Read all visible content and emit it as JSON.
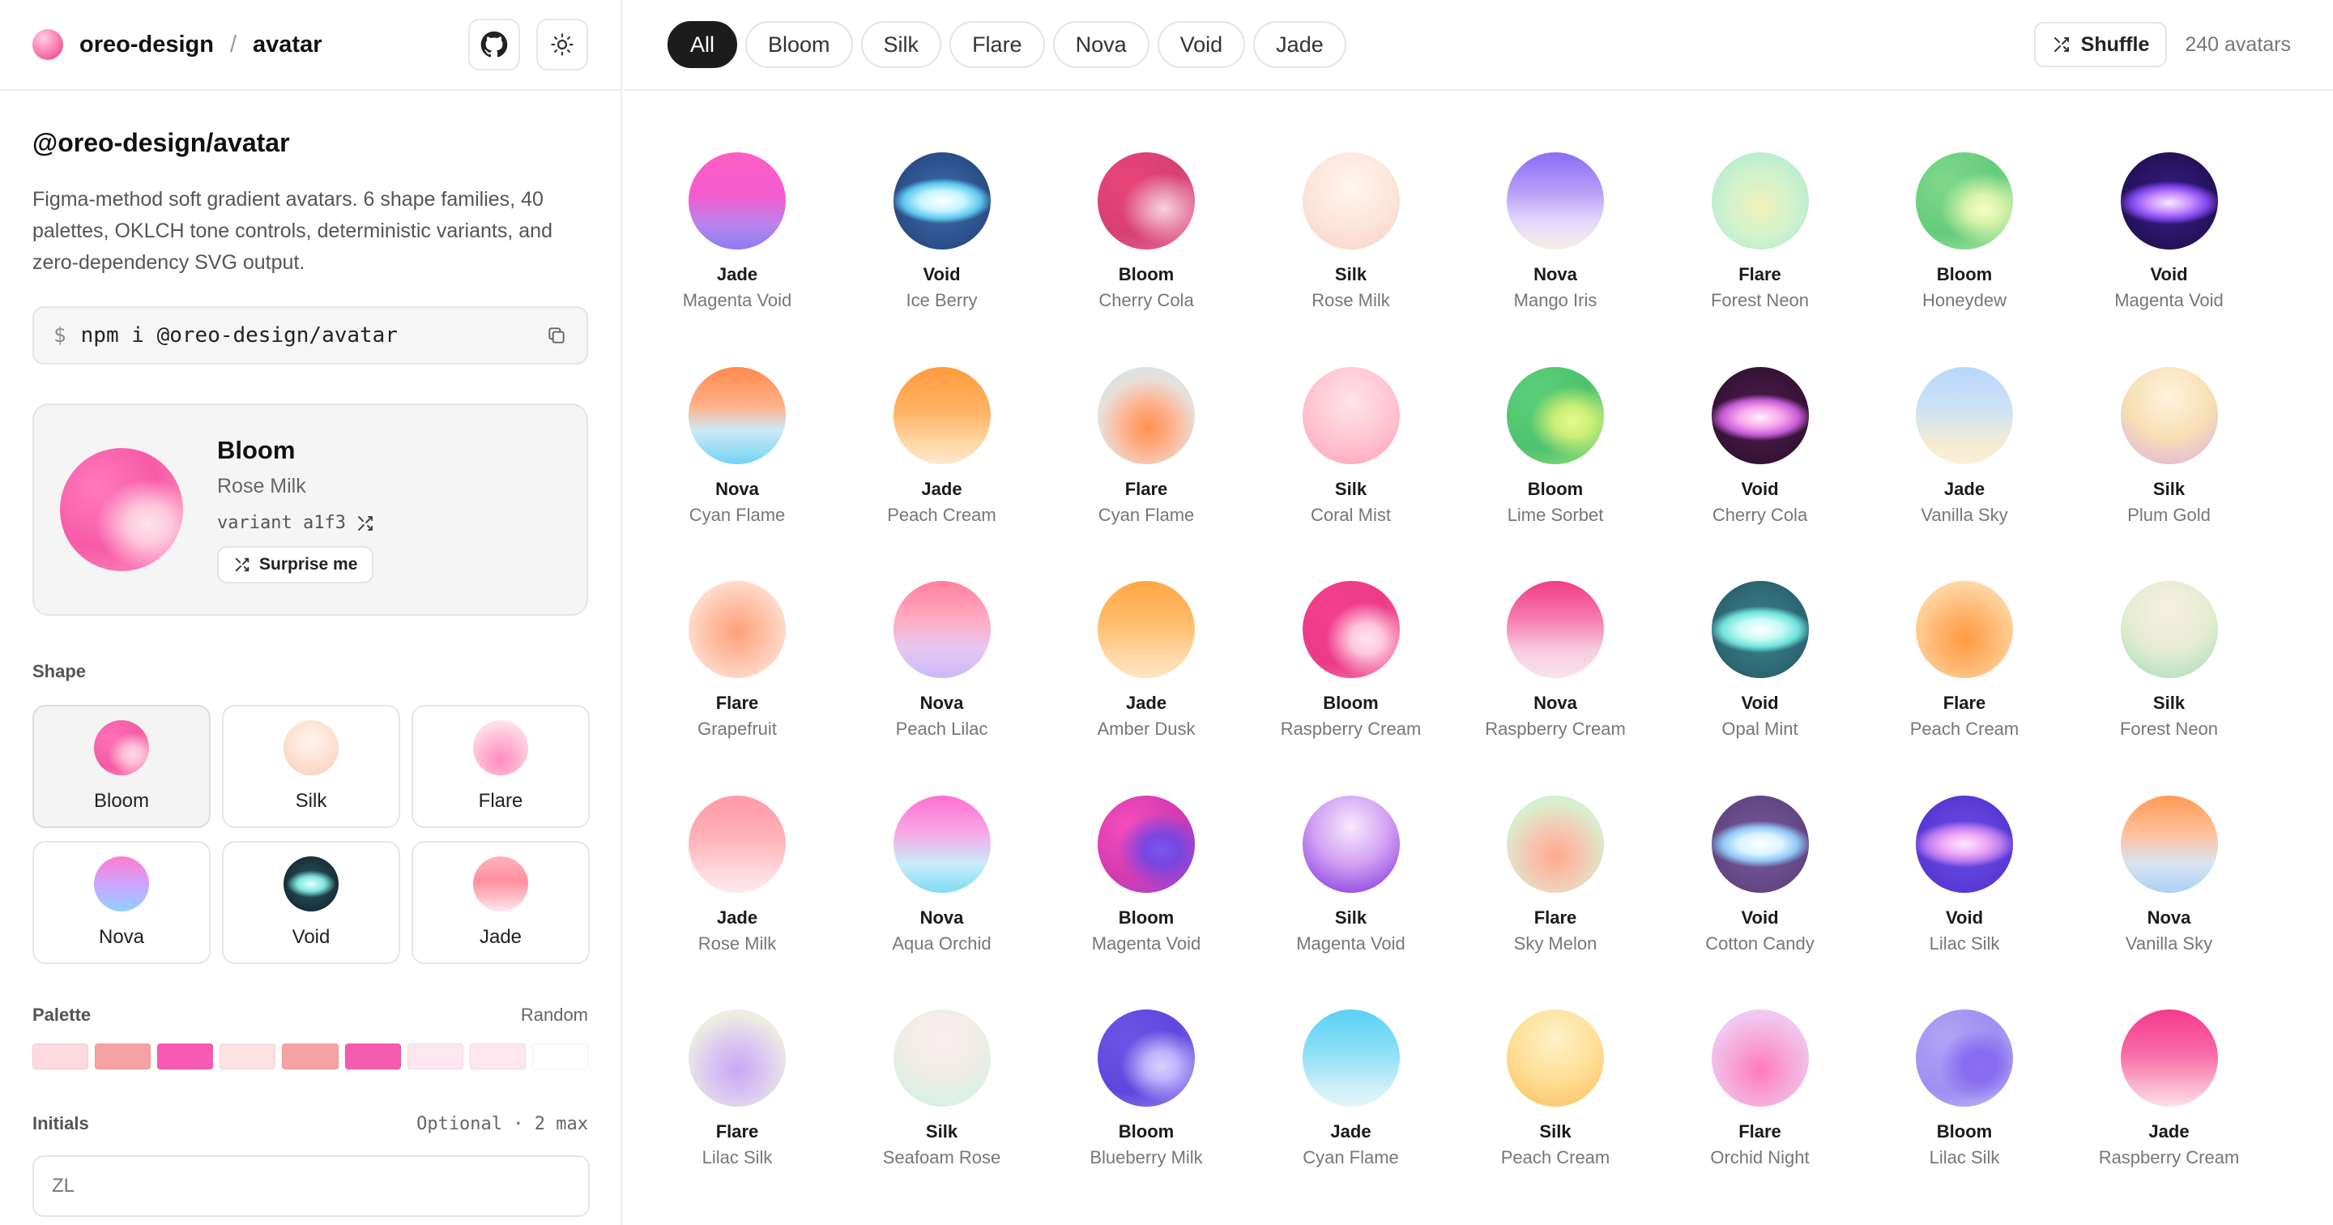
{
  "header": {
    "brand": "oreo-design",
    "separator": "/",
    "package_short": "avatar"
  },
  "sidebar": {
    "package_title": "@oreo-design/avatar",
    "description": "Figma-method soft gradient avatars. 6 shape families, 40 palettes, OKLCH tone controls, deterministic variants, and zero-dependency SVG output.",
    "install": {
      "prompt": "$",
      "command": "npm i @oreo-design/avatar"
    },
    "preview": {
      "shape": "Bloom",
      "palette": "Rose Milk",
      "variant": "variant a1f3",
      "surprise_label": "Surprise me"
    },
    "shape_section": {
      "label": "Shape",
      "items": [
        {
          "name": "Bloom",
          "active": true,
          "bg": "radial-gradient(ellipse at 70% 62%, #ffd8e6 0%, rgba(255,200,220,0.9) 18%, rgba(255,120,180,0) 45%), radial-gradient(circle at 30% 32%, #ff6fb8 0%, #f45ca5 55%, #ff9ac4 100%)"
        },
        {
          "name": "Silk",
          "active": false,
          "bg": "radial-gradient(circle at 50% 38%, #fff4ec 0%, #fde0d0 55%, #f7c9b8 100%)"
        },
        {
          "name": "Flare",
          "active": false,
          "bg": "radial-gradient(circle at 50% 72%, #ff8cc0 0%, #ffb0d0 35%, #fde2ea 80%)"
        },
        {
          "name": "Nova",
          "active": false,
          "bg": "linear-gradient(180deg, #ff7ccf 0%, #c8a8ff 55%, #8fd3ff 100%)"
        },
        {
          "name": "Void",
          "active": false,
          "bg": "radial-gradient(ellipse 62% 34% at 50% 50%, #e8fffd 0%, #7ee6e0 40%, rgba(30,70,80,0) 72%), radial-gradient(circle at 50% 50%, #2d5a63 0%, #17303a 70%, #0e1e26 100%)"
        },
        {
          "name": "Jade",
          "active": false,
          "bg": "linear-gradient(180deg, #ffb3b8 0%, #ff8fa0 45%, #fde6ea 100%)"
        }
      ]
    },
    "palette_section": {
      "label": "Palette",
      "random_label": "Random",
      "swatches": [
        "#fcd8df",
        "#f6a1a3",
        "#f65ab2",
        "#fde0e2",
        "#f6a2a2",
        "#f55cb0",
        "#fce6f0",
        "#fde6ee",
        "#ffffff"
      ]
    },
    "initials_section": {
      "label": "Initials",
      "hint": "Optional · 2 max",
      "value": "ZL"
    }
  },
  "toolbar": {
    "filters": [
      {
        "label": "All",
        "active": true
      },
      {
        "label": "Bloom",
        "active": false
      },
      {
        "label": "Silk",
        "active": false
      },
      {
        "label": "Flare",
        "active": false
      },
      {
        "label": "Nova",
        "active": false
      },
      {
        "label": "Void",
        "active": false
      },
      {
        "label": "Jade",
        "active": false
      }
    ],
    "shuffle_label": "Shuffle",
    "count_label": "240 avatars"
  },
  "avatars": [
    {
      "shape": "Jade",
      "palette": "Magenta Void",
      "bg": "linear-gradient(180deg, #ff5dc2 0%, #f35cd0 45%, #b884ec 75%, #8a7df0 100%)"
    },
    {
      "shape": "Void",
      "palette": "Ice Berry",
      "bg": "radial-gradient(ellipse 66% 30% at 50% 50%, #ffffff 0%, #c6f5ff 35%, #5fc9f0 60%, rgba(40,70,130,0) 78%), radial-gradient(circle, #3d6fb0 0%, #2b4d86 70%, #1f3866 100%)"
    },
    {
      "shape": "Bloom",
      "palette": "Cherry Cola",
      "bg": "radial-gradient(ellipse at 68% 58%, #f6d3dc 0%, rgba(240,180,200,0.8) 18%, rgba(220,80,120,0) 45%), radial-gradient(circle at 30% 30%, #e8457a 0%, #d63f73 55%, #ec7799 100%)"
    },
    {
      "shape": "Silk",
      "palette": "Rose Milk",
      "bg": "radial-gradient(circle at 50% 35%, #fff6f0 0%, #fde4d8 55%, #f8d0c4 100%)"
    },
    {
      "shape": "Nova",
      "palette": "Mango Iris",
      "bg": "linear-gradient(180deg, #8a6cf5 0%, #b69ef7 40%, #e3d5fb 70%, #f8efe6 100%)"
    },
    {
      "shape": "Flare",
      "palette": "Forest Neon",
      "bg": "radial-gradient(circle at 50% 55%, #f3f0b8 0%, #d4f3cb 40%, #b7ecd1 80%)"
    },
    {
      "shape": "Bloom",
      "palette": "Honeydew",
      "bg": "radial-gradient(ellipse at 70% 58%, #f7fbc8 0%, rgba(235,250,180,0.85) 18%, rgba(140,220,130,0) 45%), radial-gradient(circle at 30% 30%, #7fd88a 0%, #65cc7d 55%, #b9eaa4 100%)"
    },
    {
      "shape": "Void",
      "palette": "Magenta Void",
      "bg": "radial-gradient(ellipse 66% 28% at 50% 52%, #f8ecff 0%, #c48bff 35%, #7d44e8 60%, rgba(40,20,90,0) 80%), radial-gradient(circle, #3a1d8a 0%, #241259 70%, #160a3c 100%)"
    },
    {
      "shape": "Nova",
      "palette": "Cyan Flame",
      "bg": "linear-gradient(180deg, #ff8a4c 0%, #ffb089 40%, #cde9f7 65%, #72d4f2 100%)"
    },
    {
      "shape": "Jade",
      "palette": "Peach Cream",
      "bg": "linear-gradient(180deg, #ff9b3d 0%, #ffb264 45%, #ffd9a8 80%, #ffe9cc 100%)"
    },
    {
      "shape": "Flare",
      "palette": "Cyan Flame",
      "bg": "radial-gradient(circle at 52% 62%, #ff9150 0%, #ffb08a 30%, #e9dfd9 62%, #bfe6ee 100%)"
    },
    {
      "shape": "Silk",
      "palette": "Coral Mist",
      "bg": "radial-gradient(circle at 50% 35%, #ffe3ea 0%, #ffc3d0 55%, #ff9fb4 100%)"
    },
    {
      "shape": "Bloom",
      "palette": "Lime Sorbet",
      "bg": "radial-gradient(ellipse at 68% 56%, #e8f98a 0%, rgba(225,245,120,0.85) 20%, rgba(100,210,120,0) 46%), radial-gradient(circle at 30% 30%, #5ccf79 0%, #4dc26e 55%, #a9e87c 100%)"
    },
    {
      "shape": "Void",
      "palette": "Cherry Cola",
      "bg": "radial-gradient(ellipse 66% 30% at 50% 52%, #fff0fb 0%, #f6a6ec 35%, #c65bd6 60%, rgba(70,20,70,0) 80%), radial-gradient(circle, #4e1f4f 0%, #351236 70%, #230a24 100%)"
    },
    {
      "shape": "Jade",
      "palette": "Vanilla Sky",
      "bg": "linear-gradient(180deg, #b7d7fb 0%, #cfe2f4 45%, #f5ecd0 80%, #fbf0d8 100%)"
    },
    {
      "shape": "Silk",
      "palette": "Plum Gold",
      "bg": "radial-gradient(circle at 50% 30%, #fff3de 0%, #f7dfb4 50%, #e2b8d8 90%, #cfa6d9 100%)"
    },
    {
      "shape": "Flare",
      "palette": "Grapefruit",
      "bg": "radial-gradient(circle at 50% 52%, #ff9f7c 0%, #ffc0a6 40%, #ffe2d6 80%)"
    },
    {
      "shape": "Nova",
      "palette": "Peach Lilac",
      "bg": "linear-gradient(180deg, #ff7fa0 0%, #ffaac0 38%, #e4c8f2 70%, #cdb8f6 100%)"
    },
    {
      "shape": "Jade",
      "palette": "Amber Dusk",
      "bg": "linear-gradient(180deg, #ffa745 0%, #ffbe6e 45%, #ffd9a9 80%, #ffe5c0 100%)"
    },
    {
      "shape": "Bloom",
      "palette": "Raspberry Cream",
      "bg": "radial-gradient(ellipse at 66% 60%, #ffe5ef 0%, rgba(255,215,230,0.9) 18%, rgba(240,80,150,0) 45%), radial-gradient(circle at 30% 30%, #f43f8f 0%, #eb3a86 55%, #fb86b6 100%)"
    },
    {
      "shape": "Nova",
      "palette": "Raspberry Cream",
      "bg": "linear-gradient(180deg, #f03d86 0%, #f779ad 38%, #f7cde0 72%, #fbe3ea 100%)"
    },
    {
      "shape": "Void",
      "palette": "Opal Mint",
      "bg": "radial-gradient(ellipse 66% 30% at 50% 50%, #ffffff 0%, #c6fbf6 35%, #6fe2dc 60%, rgba(30,100,110,0) 80%), radial-gradient(circle, #3f868f 0%, #2b6470 70%, #1d4650 100%)"
    },
    {
      "shape": "Flare",
      "palette": "Peach Cream",
      "bg": "radial-gradient(circle at 50% 60%, #ff9a45 0%, #ffb46c 35%, #ffd3a0 70%, #ffe3bd 100%)"
    },
    {
      "shape": "Silk",
      "palette": "Forest Neon",
      "bg": "radial-gradient(circle at 50% 30%, #f8efe2 0%, #e5ecd0 50%, #b7e1c1 85%, #9fd7ae 100%)"
    },
    {
      "shape": "Jade",
      "palette": "Rose Milk",
      "bg": "linear-gradient(180deg, #ff9aa4 0%, #ffb2ba 45%, #ffdadf 80%, #ffe9ec 100%)"
    },
    {
      "shape": "Nova",
      "palette": "Aqua Orchid",
      "bg": "linear-gradient(180deg, #ff6fd0 0%, #f7a8e6 38%, #c9ecfa 70%, #7fdcf6 100%)"
    },
    {
      "shape": "Bloom",
      "palette": "Magenta Void",
      "bg": "radial-gradient(ellipse at 66% 56%, #7b55ee 0%, rgba(110,70,230,0.9) 20%, rgba(230,60,180,0) 48%), radial-gradient(circle at 30% 30%, #f24cbd 0%, #d53bb0 55%, #8a4ae0 100%)"
    },
    {
      "shape": "Silk",
      "palette": "Magenta Void",
      "bg": "radial-gradient(circle at 50% 32%, #f8e8ff 0%, #d3a3f3 45%, #9a57e5 80%, #7a3fd8 100%)"
    },
    {
      "shape": "Flare",
      "palette": "Sky Melon",
      "bg": "radial-gradient(circle at 50% 62%, #ffa98e 0%, #f5c7b2 35%, #d8efce 70%, #c8ecd1 100%)"
    },
    {
      "shape": "Void",
      "palette": "Cotton Candy",
      "bg": "radial-gradient(ellipse 66% 30% at 50% 50%, #ffffff 0%, #d9f3ff 35%, #90c8f6 58%, rgba(90,60,120,0) 80%), radial-gradient(circle, #7a5aa0 0%, #604682 70%, #47336a 100%)"
    },
    {
      "shape": "Void",
      "palette": "Lilac Silk",
      "bg": "radial-gradient(ellipse 66% 30% at 50% 50%, #fde8ff 0%, #f0a8f6 35%, #b97bf0 58%, rgba(80,50,200,0) 80%), radial-gradient(circle, #6b4ee6 0%, #5838d4 70%, #432ab8 100%)"
    },
    {
      "shape": "Nova",
      "palette": "Vanilla Sky",
      "bg": "linear-gradient(180deg, #ff9b55 0%, #ffbf9a 38%, #d9e3f2 70%, #a9d2f5 100%)"
    },
    {
      "shape": "Flare",
      "palette": "Lilac Silk",
      "bg": "radial-gradient(circle at 50% 62%, #c9a7f3 0%, #d9c6f3 35%, #ecece0 70%, #f2f1e6 100%)"
    },
    {
      "shape": "Silk",
      "palette": "Seafoam Rose",
      "bg": "radial-gradient(circle at 50% 30%, #fbeff0 0%, #f0ece6 45%, #d8f1e5 80%, #c9eedd 100%)"
    },
    {
      "shape": "Bloom",
      "palette": "Blueberry Milk",
      "bg": "radial-gradient(ellipse at 66% 58%, #d7d1ff 0%, rgba(200,190,255,0.9) 18%, rgba(110,80,230,0) 45%), radial-gradient(circle at 30% 30%, #6b55e6 0%, #5f47dd 55%, #9f8bf2 100%)"
    },
    {
      "shape": "Jade",
      "palette": "Cyan Flame",
      "bg": "linear-gradient(180deg, #5bd1f6 0%, #8ee0f6 45%, #cdeff8 80%, #e4f6fa 100%)"
    },
    {
      "shape": "Silk",
      "palette": "Peach Cream",
      "bg": "radial-gradient(circle at 50% 30%, #fff1c9 0%, #ffdf95 50%, #fbc46a 90%, #f8b757 100%)"
    },
    {
      "shape": "Flare",
      "palette": "Orchid Night",
      "bg": "radial-gradient(circle at 50% 62%, #ff78c0 0%, #f7a3d6 35%, #f1c6ef 70%, #eed6f3 100%)"
    },
    {
      "shape": "Bloom",
      "palette": "Lilac Silk",
      "bg": "radial-gradient(ellipse at 66% 58%, #8a6ef0 0%, rgba(130,100,240,0.85) 18%, rgba(160,140,250,0) 45%), radial-gradient(circle at 30% 30%, #b0a3f6 0%, #9d8ff0 55%, #c9bff8 100%)"
    },
    {
      "shape": "Jade",
      "palette": "Raspberry Cream",
      "bg": "linear-gradient(180deg, #f53a8c 0%, #f86aa6 45%, #fbb6cf 80%, #fde0ea 100%)"
    }
  ]
}
